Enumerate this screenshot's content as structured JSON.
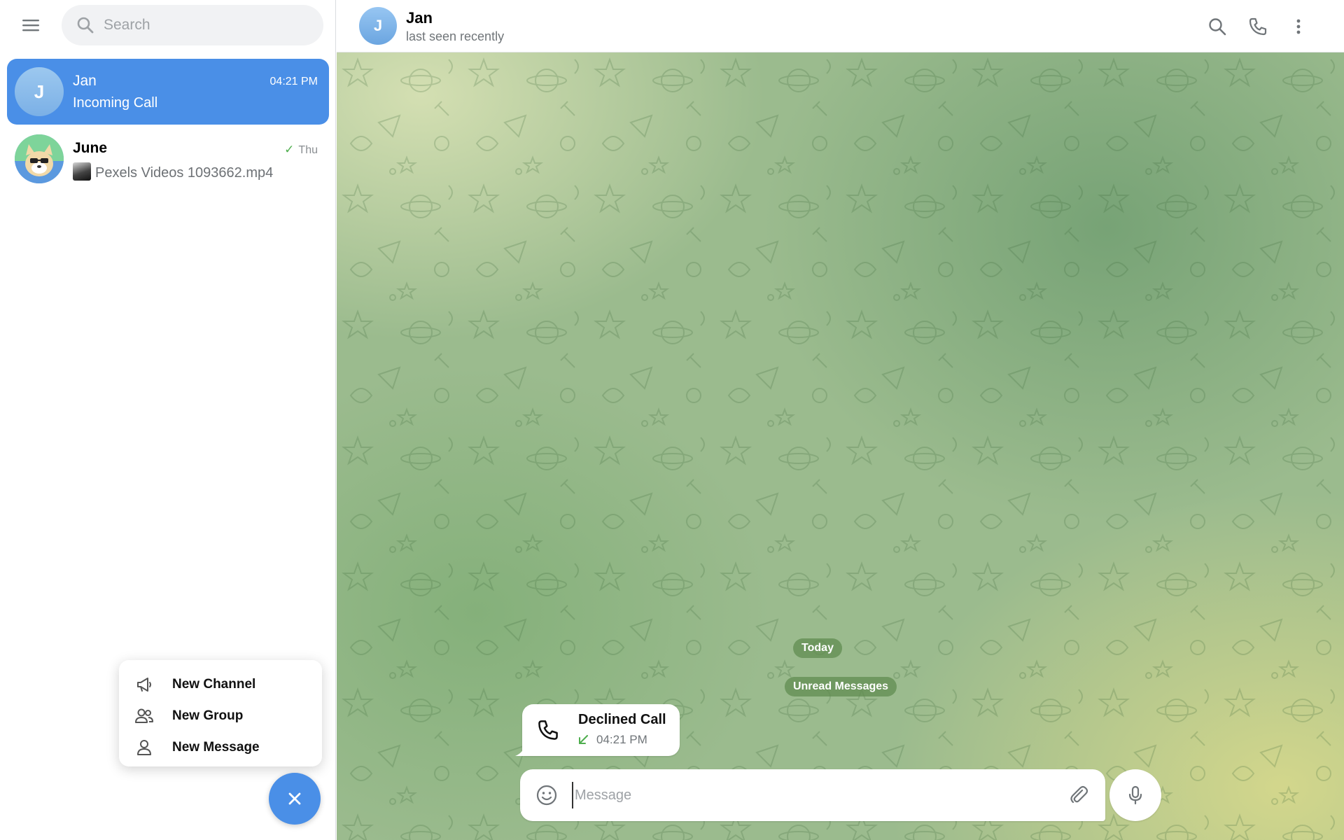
{
  "colors": {
    "accent": "#4a8fe7",
    "check": "#4fae4e",
    "secondary_text": "#707579"
  },
  "sidebar": {
    "menu_icon": "hamburger-menu-icon",
    "search": {
      "placeholder": "Search",
      "value": ""
    },
    "chats": [
      {
        "name": "Jan",
        "avatar_letter": "J",
        "time": "04:21 PM",
        "preview": "Incoming Call",
        "active": true
      },
      {
        "name": "June",
        "avatar_icon": "dog-sticker-avatar",
        "time": "Thu",
        "read_check": "✓",
        "preview": "Pexels Videos 1093662.mp4",
        "preview_thumb": "video-thumbnail"
      }
    ],
    "new_menu": [
      {
        "icon": "megaphone-icon",
        "label": "New Channel"
      },
      {
        "icon": "group-icon",
        "label": "New Group"
      },
      {
        "icon": "person-icon",
        "label": "New Message"
      }
    ],
    "fab_icon": "close-icon"
  },
  "chat": {
    "header": {
      "avatar_letter": "J",
      "name": "Jan",
      "status": "last seen recently",
      "actions": [
        "search-icon",
        "phone-icon",
        "more-vertical-icon"
      ]
    },
    "date_label": "Today",
    "unread_label": "Unread Messages",
    "messages": [
      {
        "type": "call",
        "title": "Declined Call",
        "time": "04:21 PM",
        "direction_icon": "incoming-arrow-icon"
      }
    ],
    "composer": {
      "placeholder": "Message",
      "value": ""
    }
  }
}
